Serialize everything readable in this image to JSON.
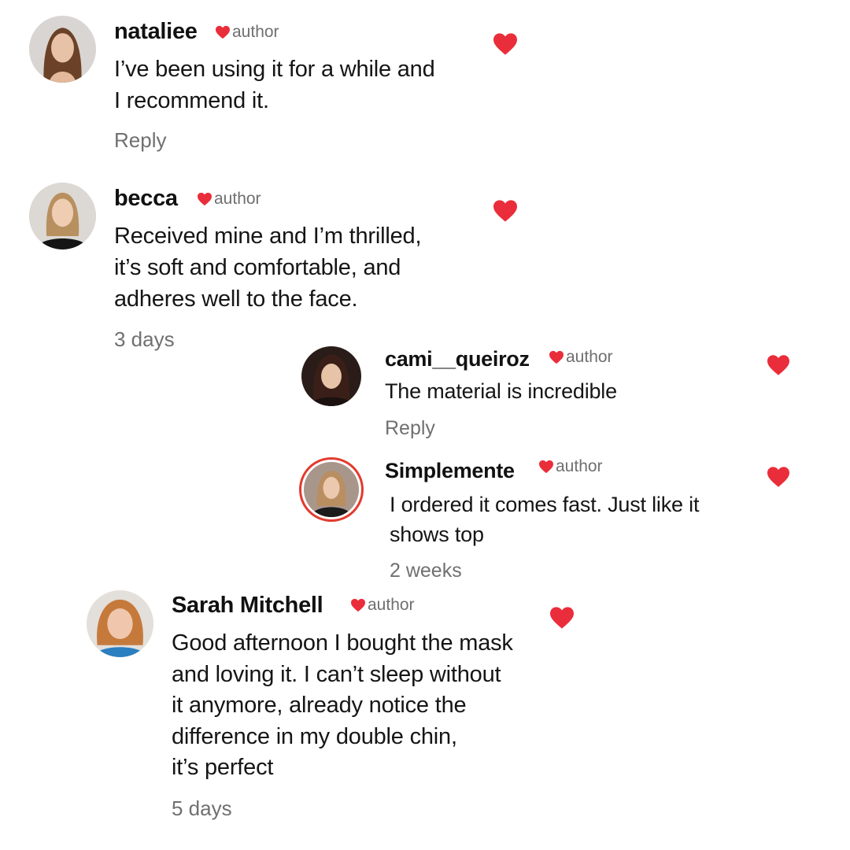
{
  "colors": {
    "heart": "#ea2d3a",
    "muted": "#707070",
    "ring": "#e23b2e"
  },
  "icons": {
    "like": "heart-icon",
    "badge": "heart-icon"
  },
  "comments": [
    {
      "username": "nataliee",
      "badge": "author",
      "lines": [
        "I’ve been using it for a while and",
        "I recommend it."
      ],
      "meta": "Reply"
    },
    {
      "username": "becca",
      "badge": "author",
      "lines": [
        "Received mine and I’m thrilled,",
        "it’s soft and comfortable, and",
        "adheres well to the face."
      ],
      "meta": "3 days"
    },
    {
      "username": "cami__queiroz",
      "badge": "author",
      "lines": [
        "The material is incredible"
      ],
      "meta": "Reply"
    },
    {
      "username": "Simplemente",
      "badge": "author",
      "lines": [
        "I ordered it comes fast. Just like it",
        "shows top"
      ],
      "meta": "2 weeks"
    },
    {
      "username": "Sarah Mitchell",
      "badge": "author",
      "lines": [
        "Good afternoon  I bought the mask",
        "and loving it. I can’t sleep without",
        "it anymore, already notice the",
        "difference in my double chin,",
        "it’s perfect"
      ],
      "meta": "5 days"
    }
  ]
}
